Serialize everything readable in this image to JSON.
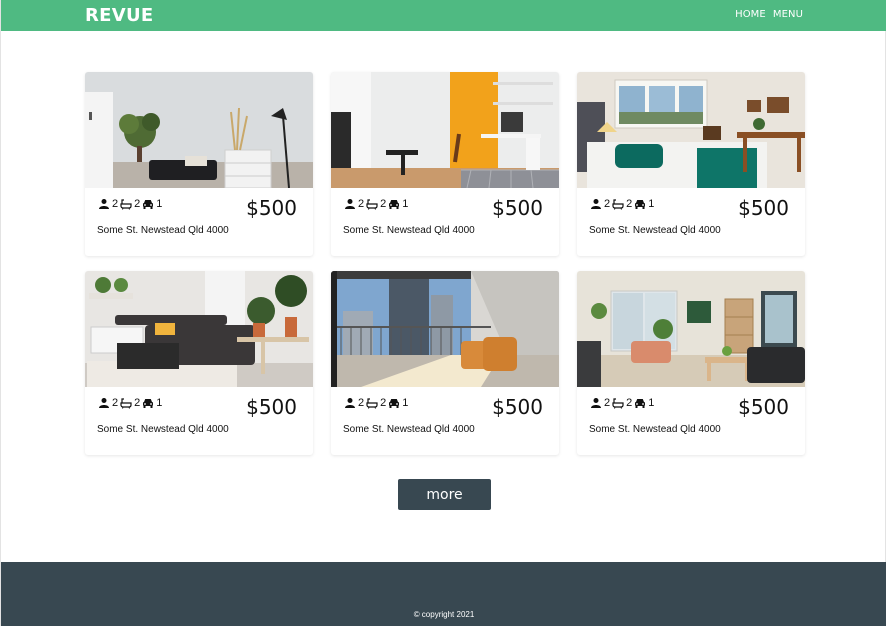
{
  "header": {
    "brand": "REVUE",
    "nav": [
      {
        "label": "HOME"
      },
      {
        "label": "MENU"
      }
    ]
  },
  "colors": {
    "header_bg": "#4fba82",
    "footer_bg": "#384851",
    "button_bg": "#384851"
  },
  "listings": [
    {
      "beds": "2",
      "baths": "2",
      "cars": "1",
      "price": "$500",
      "address": "Some St. Newstead Qld 4000",
      "photo": "living-room-plant"
    },
    {
      "beds": "2",
      "baths": "2",
      "cars": "1",
      "price": "$500",
      "address": "Some St. Newstead Qld 4000",
      "photo": "study-desk-orange-wall"
    },
    {
      "beds": "2",
      "baths": "2",
      "cars": "1",
      "price": "$500",
      "address": "Some St. Newstead Qld 4000",
      "photo": "bedroom"
    },
    {
      "beds": "2",
      "baths": "2",
      "cars": "1",
      "price": "$500",
      "address": "Some St. Newstead Qld 4000",
      "photo": "lounge-sofa"
    },
    {
      "beds": "2",
      "baths": "2",
      "cars": "1",
      "price": "$500",
      "address": "Some St. Newstead Qld 4000",
      "photo": "balcony-chairs"
    },
    {
      "beds": "2",
      "baths": "2",
      "cars": "1",
      "price": "$500",
      "address": "Some St. Newstead Qld 4000",
      "photo": "bright-living-room"
    }
  ],
  "icons": {
    "beds": "person-icon",
    "baths": "bathtub-icon",
    "cars": "car-icon"
  },
  "more_button": "more",
  "footer": {
    "copyright": "© copyright 2021"
  }
}
